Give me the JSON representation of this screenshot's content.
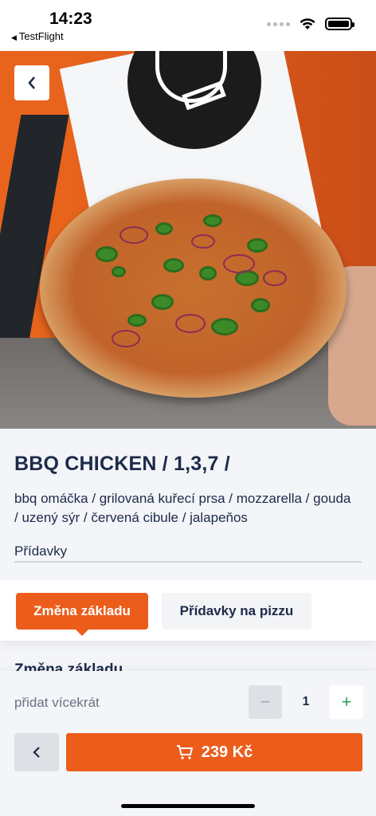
{
  "status_bar": {
    "time": "14:23",
    "back_app": "TestFlight"
  },
  "hero": {
    "back_icon": "chevron-left-icon"
  },
  "product": {
    "title": "BBQ CHICKEN / 1,3,7 /",
    "description": "bbq omáčka / grilovaná kuřecí prsa / mozzarella / gouda / uzený sýr / červená cibule / jalapeňos",
    "extras_label": "Přídavky"
  },
  "tabs": [
    {
      "label": "Změna základu",
      "active": true
    },
    {
      "label": "Přídavky na pizzu",
      "active": false
    }
  ],
  "section_peek": "Změna základu",
  "quantity": {
    "label": "přidat vícekrát",
    "value": "1",
    "minus": "−",
    "plus": "+"
  },
  "actions": {
    "back_symbol": "‹",
    "cart_price": "239 Kč",
    "cart_icon": "cart-icon"
  },
  "colors": {
    "accent": "#ec5d1c",
    "text": "#1d2a4a",
    "plus": "#27a35a"
  }
}
